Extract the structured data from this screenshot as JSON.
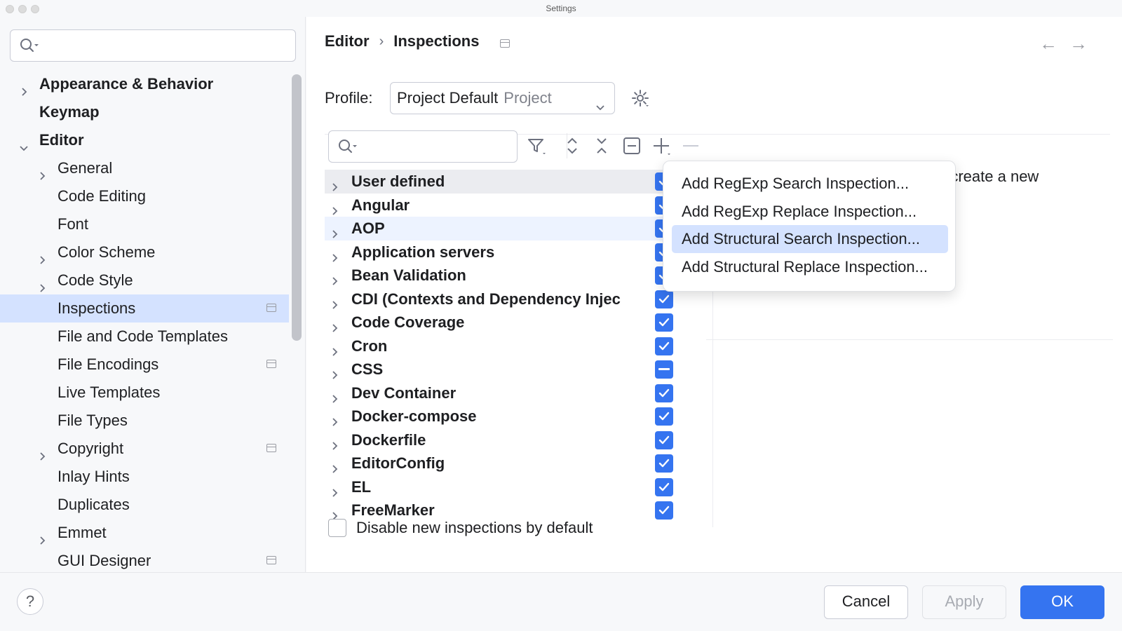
{
  "window": {
    "title": "Settings"
  },
  "sidebar": {
    "items": [
      {
        "label": "Appearance & Behavior",
        "level": 0,
        "bold": true,
        "expander": "collapsed"
      },
      {
        "label": "Keymap",
        "level": 0,
        "bold": true,
        "expander": "none"
      },
      {
        "label": "Editor",
        "level": 0,
        "bold": true,
        "expander": "expanded"
      },
      {
        "label": "General",
        "level": 1,
        "expander": "collapsed"
      },
      {
        "label": "Code Editing",
        "level": 1,
        "expander": "none"
      },
      {
        "label": "Font",
        "level": 1,
        "expander": "none"
      },
      {
        "label": "Color Scheme",
        "level": 1,
        "expander": "collapsed"
      },
      {
        "label": "Code Style",
        "level": 1,
        "expander": "collapsed"
      },
      {
        "label": "Inspections",
        "level": 1,
        "expander": "none",
        "selected": true,
        "project": true
      },
      {
        "label": "File and Code Templates",
        "level": 1,
        "expander": "none"
      },
      {
        "label": "File Encodings",
        "level": 1,
        "expander": "none",
        "project": true
      },
      {
        "label": "Live Templates",
        "level": 1,
        "expander": "none"
      },
      {
        "label": "File Types",
        "level": 1,
        "expander": "none"
      },
      {
        "label": "Copyright",
        "level": 1,
        "expander": "collapsed",
        "project": true
      },
      {
        "label": "Inlay Hints",
        "level": 1,
        "expander": "none"
      },
      {
        "label": "Duplicates",
        "level": 1,
        "expander": "none"
      },
      {
        "label": "Emmet",
        "level": 1,
        "expander": "collapsed"
      },
      {
        "label": "GUI Designer",
        "level": 1,
        "expander": "none",
        "project": true
      }
    ]
  },
  "breadcrumb": {
    "parent": "Editor",
    "separator": "›",
    "current": "Inspections"
  },
  "profile": {
    "label": "Profile:",
    "value": "Project Default",
    "scope": "Project"
  },
  "inspections": {
    "rows": [
      {
        "label": "User defined",
        "state": "checked"
      },
      {
        "label": "Angular",
        "state": "checked"
      },
      {
        "label": "AOP",
        "state": "checked"
      },
      {
        "label": "Application servers",
        "state": "checked"
      },
      {
        "label": "Bean Validation",
        "state": "checked"
      },
      {
        "label": "CDI (Contexts and Dependency Injec",
        "state": "checked"
      },
      {
        "label": "Code Coverage",
        "state": "checked"
      },
      {
        "label": "Cron",
        "state": "checked"
      },
      {
        "label": "CSS",
        "state": "mixed"
      },
      {
        "label": "Dev Container",
        "state": "checked"
      },
      {
        "label": "Docker-compose",
        "state": "checked"
      },
      {
        "label": "Dockerfile",
        "state": "checked"
      },
      {
        "label": "EditorConfig",
        "state": "checked"
      },
      {
        "label": "EL",
        "state": "checked"
      },
      {
        "label": "FreeMarker",
        "state": "checked"
      }
    ]
  },
  "description": {
    "partial_text": "o create a new"
  },
  "popup": {
    "items": [
      "Add RegExp Search Inspection...",
      "Add RegExp Replace Inspection...",
      "Add Structural Search Inspection...",
      "Add Structural Replace Inspection..."
    ],
    "active_index": 2
  },
  "disable_new": {
    "label": "Disable new inspections by default",
    "checked": false
  },
  "footer": {
    "help": "?",
    "cancel": "Cancel",
    "apply": "Apply",
    "ok": "OK"
  },
  "colors": {
    "accent": "#3574f0",
    "selection": "#d4e2ff"
  }
}
